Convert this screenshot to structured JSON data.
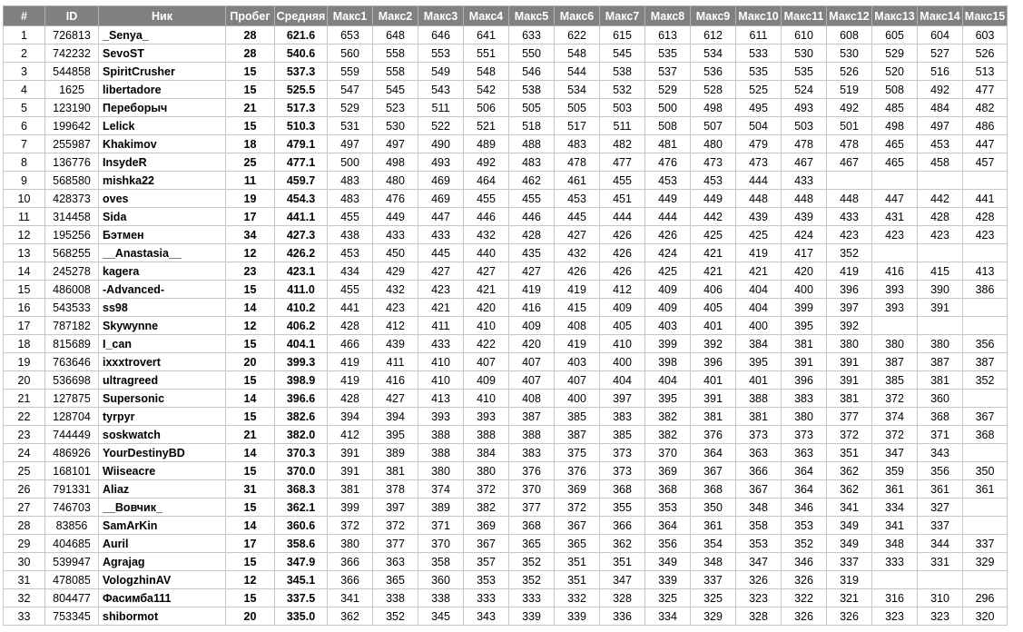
{
  "columns": [
    "#",
    "ID",
    "Ник",
    "Пробег",
    "Средняя",
    "Макс1",
    "Макс2",
    "Макс3",
    "Макс4",
    "Макс5",
    "Макс6",
    "Макс7",
    "Макс8",
    "Макс9",
    "Макс10",
    "Макс11",
    "Макс12",
    "Макс13",
    "Макс14",
    "Макс15"
  ],
  "rows": [
    [
      "1",
      "726813",
      "_Senya_",
      "28",
      "621.6",
      "653",
      "648",
      "646",
      "641",
      "633",
      "622",
      "615",
      "613",
      "612",
      "611",
      "610",
      "608",
      "605",
      "604",
      "603"
    ],
    [
      "2",
      "742232",
      "SevoST",
      "28",
      "540.6",
      "560",
      "558",
      "553",
      "551",
      "550",
      "548",
      "545",
      "535",
      "534",
      "533",
      "530",
      "530",
      "529",
      "527",
      "526"
    ],
    [
      "3",
      "544858",
      "SpiritCrusher",
      "15",
      "537.3",
      "559",
      "558",
      "549",
      "548",
      "546",
      "544",
      "538",
      "537",
      "536",
      "535",
      "535",
      "526",
      "520",
      "516",
      "513"
    ],
    [
      "4",
      "1625",
      "libertadore",
      "15",
      "525.5",
      "547",
      "545",
      "543",
      "542",
      "538",
      "534",
      "532",
      "529",
      "528",
      "525",
      "524",
      "519",
      "508",
      "492",
      "477"
    ],
    [
      "5",
      "123190",
      "Переборыч",
      "21",
      "517.3",
      "529",
      "523",
      "511",
      "506",
      "505",
      "505",
      "503",
      "500",
      "498",
      "495",
      "493",
      "492",
      "485",
      "484",
      "482"
    ],
    [
      "6",
      "199642",
      "Lelick",
      "15",
      "510.3",
      "531",
      "530",
      "522",
      "521",
      "518",
      "517",
      "511",
      "508",
      "507",
      "504",
      "503",
      "501",
      "498",
      "497",
      "486"
    ],
    [
      "7",
      "255987",
      "Khakimov",
      "18",
      "479.1",
      "497",
      "497",
      "490",
      "489",
      "488",
      "483",
      "482",
      "481",
      "480",
      "479",
      "478",
      "478",
      "465",
      "453",
      "447"
    ],
    [
      "8",
      "136776",
      "InsydeR",
      "25",
      "477.1",
      "500",
      "498",
      "493",
      "492",
      "483",
      "478",
      "477",
      "476",
      "473",
      "473",
      "467",
      "467",
      "465",
      "458",
      "457"
    ],
    [
      "9",
      "568580",
      "mishka22",
      "11",
      "459.7",
      "483",
      "480",
      "469",
      "464",
      "462",
      "461",
      "455",
      "453",
      "453",
      "444",
      "433",
      "",
      "",
      "",
      ""
    ],
    [
      "10",
      "428373",
      "oves",
      "19",
      "454.3",
      "483",
      "476",
      "469",
      "455",
      "455",
      "453",
      "451",
      "449",
      "449",
      "448",
      "448",
      "448",
      "447",
      "442",
      "441"
    ],
    [
      "11",
      "314458",
      "Sida",
      "17",
      "441.1",
      "455",
      "449",
      "447",
      "446",
      "446",
      "445",
      "444",
      "444",
      "442",
      "439",
      "439",
      "433",
      "431",
      "428",
      "428"
    ],
    [
      "12",
      "195256",
      "Бэтмен",
      "34",
      "427.3",
      "438",
      "433",
      "433",
      "432",
      "428",
      "427",
      "426",
      "426",
      "425",
      "425",
      "424",
      "423",
      "423",
      "423",
      "423"
    ],
    [
      "13",
      "568255",
      "__Anastasia__",
      "12",
      "426.2",
      "453",
      "450",
      "445",
      "440",
      "435",
      "432",
      "426",
      "424",
      "421",
      "419",
      "417",
      "352",
      "",
      "",
      ""
    ],
    [
      "14",
      "245278",
      "kagera",
      "23",
      "423.1",
      "434",
      "429",
      "427",
      "427",
      "427",
      "426",
      "426",
      "425",
      "421",
      "421",
      "420",
      "419",
      "416",
      "415",
      "413"
    ],
    [
      "15",
      "486008",
      "-Advanced-",
      "15",
      "411.0",
      "455",
      "432",
      "423",
      "421",
      "419",
      "419",
      "412",
      "409",
      "406",
      "404",
      "400",
      "396",
      "393",
      "390",
      "386"
    ],
    [
      "16",
      "543533",
      "ss98",
      "14",
      "410.2",
      "441",
      "423",
      "421",
      "420",
      "416",
      "415",
      "409",
      "409",
      "405",
      "404",
      "399",
      "397",
      "393",
      "391",
      ""
    ],
    [
      "17",
      "787182",
      "Skywynne",
      "12",
      "406.2",
      "428",
      "412",
      "411",
      "410",
      "409",
      "408",
      "405",
      "403",
      "401",
      "400",
      "395",
      "392",
      "",
      "",
      ""
    ],
    [
      "18",
      "815689",
      "I_can",
      "15",
      "404.1",
      "466",
      "439",
      "433",
      "422",
      "420",
      "419",
      "410",
      "399",
      "392",
      "384",
      "381",
      "380",
      "380",
      "380",
      "356"
    ],
    [
      "19",
      "763646",
      "ixxxtrovert",
      "20",
      "399.3",
      "419",
      "411",
      "410",
      "407",
      "407",
      "403",
      "400",
      "398",
      "396",
      "395",
      "391",
      "391",
      "387",
      "387",
      "387"
    ],
    [
      "20",
      "536698",
      "ultragreed",
      "15",
      "398.9",
      "419",
      "416",
      "410",
      "409",
      "407",
      "407",
      "404",
      "404",
      "401",
      "401",
      "396",
      "391",
      "385",
      "381",
      "352"
    ],
    [
      "21",
      "127875",
      "Supersonic",
      "14",
      "396.6",
      "428",
      "427",
      "413",
      "410",
      "408",
      "400",
      "397",
      "395",
      "391",
      "388",
      "383",
      "381",
      "372",
      "360",
      ""
    ],
    [
      "22",
      "128704",
      "tyrpyr",
      "15",
      "382.6",
      "394",
      "394",
      "393",
      "393",
      "387",
      "385",
      "383",
      "382",
      "381",
      "381",
      "380",
      "377",
      "374",
      "368",
      "367"
    ],
    [
      "23",
      "744449",
      "soskwatch",
      "21",
      "382.0",
      "412",
      "395",
      "388",
      "388",
      "388",
      "387",
      "385",
      "382",
      "376",
      "373",
      "373",
      "372",
      "372",
      "371",
      "368"
    ],
    [
      "24",
      "486926",
      "YourDestinyBD",
      "14",
      "370.3",
      "391",
      "389",
      "388",
      "384",
      "383",
      "375",
      "373",
      "370",
      "364",
      "363",
      "363",
      "351",
      "347",
      "343",
      ""
    ],
    [
      "25",
      "168101",
      "Wiiseacre",
      "15",
      "370.0",
      "391",
      "381",
      "380",
      "380",
      "376",
      "376",
      "373",
      "369",
      "367",
      "366",
      "364",
      "362",
      "359",
      "356",
      "350"
    ],
    [
      "26",
      "791331",
      "Aliaz",
      "31",
      "368.3",
      "381",
      "378",
      "374",
      "372",
      "370",
      "369",
      "368",
      "368",
      "368",
      "367",
      "364",
      "362",
      "361",
      "361",
      "361"
    ],
    [
      "27",
      "746703",
      "__Вовчик_",
      "15",
      "362.1",
      "399",
      "397",
      "389",
      "382",
      "377",
      "372",
      "355",
      "353",
      "350",
      "348",
      "346",
      "341",
      "334",
      "327",
      ""
    ],
    [
      "28",
      "83856",
      "SamArKin",
      "14",
      "360.6",
      "372",
      "372",
      "371",
      "369",
      "368",
      "367",
      "366",
      "364",
      "361",
      "358",
      "353",
      "349",
      "341",
      "337",
      ""
    ],
    [
      "29",
      "404685",
      "Auril",
      "17",
      "358.6",
      "380",
      "377",
      "370",
      "367",
      "365",
      "365",
      "362",
      "356",
      "354",
      "353",
      "352",
      "349",
      "348",
      "344",
      "337"
    ],
    [
      "30",
      "539947",
      "Agrajag",
      "15",
      "347.9",
      "366",
      "363",
      "358",
      "357",
      "352",
      "351",
      "351",
      "349",
      "348",
      "347",
      "346",
      "337",
      "333",
      "331",
      "329"
    ],
    [
      "31",
      "478085",
      "VologzhinAV",
      "12",
      "345.1",
      "366",
      "365",
      "360",
      "353",
      "352",
      "351",
      "347",
      "339",
      "337",
      "326",
      "326",
      "319",
      "",
      "",
      ""
    ],
    [
      "32",
      "804477",
      "Фасимба111",
      "15",
      "337.5",
      "341",
      "338",
      "338",
      "333",
      "333",
      "332",
      "328",
      "325",
      "325",
      "323",
      "322",
      "321",
      "316",
      "310",
      "296"
    ],
    [
      "33",
      "753345",
      "shibormot",
      "20",
      "335.0",
      "362",
      "352",
      "345",
      "343",
      "339",
      "339",
      "336",
      "334",
      "329",
      "328",
      "326",
      "326",
      "323",
      "323",
      "320"
    ]
  ]
}
